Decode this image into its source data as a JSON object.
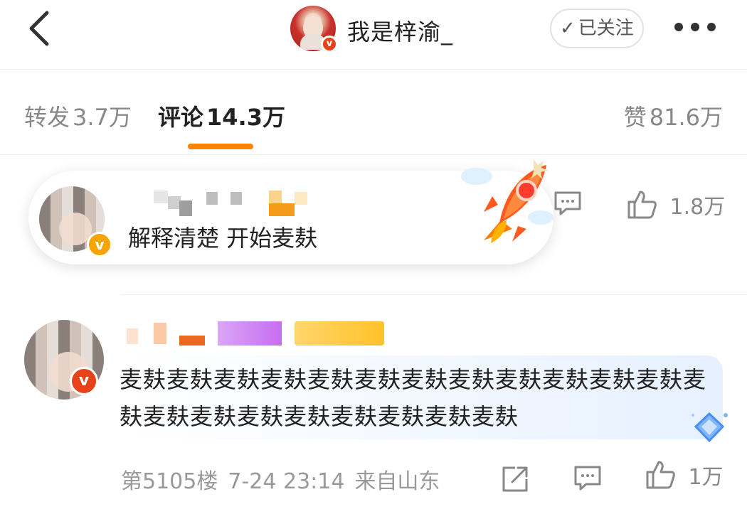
{
  "header": {
    "back_icon": "chevron-left-icon",
    "username": "我是梓渝_",
    "follow_label": "已关注",
    "follow_check": "✓",
    "more_icon": "more-dots-icon",
    "verified_badge": "v"
  },
  "tabs": {
    "repost_label": "转发",
    "repost_count": "3.7万",
    "comments_label": "评论",
    "comments_count": "14.3万",
    "likes_label": "赞",
    "likes_count": "81.6万"
  },
  "pinned_comment": {
    "text": "解释清楚 开始麦麸",
    "verified_badge": "v",
    "like_count": "1.8万",
    "colors": {
      "badge": "#f6a400"
    }
  },
  "comment": {
    "text": "麦麸麦麸麦麸麦麸麦麸麦麸麦麸麦麸麦麸麦麸麦麸麦麸麦麸麦麸麦麸麦麸麦麸麦麸麦麸麦麸麦麸",
    "verified_badge": "v",
    "floor": "第5105楼",
    "datetime": "7-24 23:14",
    "location": "来自山东",
    "like_count": "1万"
  },
  "colors": {
    "accent": "#ff8200",
    "verified_red": "#e8421a"
  }
}
